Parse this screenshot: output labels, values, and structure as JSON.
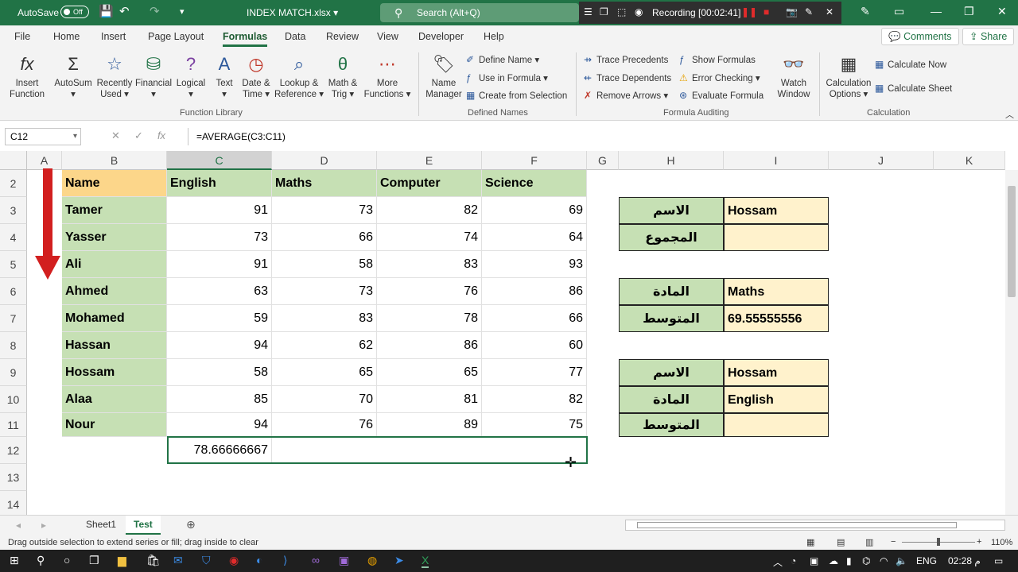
{
  "titlebar": {
    "autosave_label": "AutoSave",
    "autosave_state": "Off",
    "filename": "INDEX MATCH.xlsx",
    "search_placeholder": "Search (Alt+Q)",
    "recording_label": "Recording [00:02:41]"
  },
  "tabs": [
    "File",
    "Home",
    "Insert",
    "Page Layout",
    "Formulas",
    "Data",
    "Review",
    "View",
    "Developer",
    "Help"
  ],
  "active_tab": "Formulas",
  "comments_label": "Comments",
  "share_label": "Share",
  "ribbon": {
    "function_library": {
      "insert_function_1": "Insert",
      "insert_function_2": "Function",
      "autosum": "AutoSum",
      "recently_used_1": "Recently",
      "recently_used_2": "Used",
      "financial": "Financial",
      "logical": "Logical",
      "text": "Text",
      "date_time_1": "Date &",
      "date_time_2": "Time",
      "lookup_1": "Lookup &",
      "lookup_2": "Reference",
      "math_1": "Math &",
      "math_2": "Trig",
      "more_1": "More",
      "more_2": "Functions",
      "label": "Function Library"
    },
    "defined_names": {
      "name_manager_1": "Name",
      "name_manager_2": "Manager",
      "define_name": "Define Name",
      "use_in_formula": "Use in Formula",
      "create_from_selection": "Create from Selection",
      "label": "Defined Names"
    },
    "formula_auditing": {
      "trace_precedents": "Trace Precedents",
      "trace_dependents": "Trace Dependents",
      "remove_arrows": "Remove Arrows",
      "show_formulas": "Show Formulas",
      "error_checking": "Error Checking",
      "evaluate_formula": "Evaluate Formula",
      "watch_window_1": "Watch",
      "watch_window_2": "Window",
      "label": "Formula Auditing"
    },
    "calculation": {
      "calc_options_1": "Calculation",
      "calc_options_2": "Options",
      "calculate_now": "Calculate Now",
      "calculate_sheet": "Calculate Sheet",
      "label": "Calculation"
    }
  },
  "formula_bar": {
    "name_box": "C12",
    "formula": "=AVERAGE(C3:C11)"
  },
  "columns": [
    "A",
    "B",
    "C",
    "D",
    "E",
    "F",
    "G",
    "H",
    "I",
    "J",
    "K"
  ],
  "rows": [
    "2",
    "3",
    "4",
    "5",
    "6",
    "7",
    "8",
    "9",
    "10",
    "11",
    "12",
    "13",
    "14"
  ],
  "table": {
    "headers": [
      "Name",
      "English",
      "Maths",
      "Computer",
      "Science"
    ],
    "rows": [
      [
        "Tamer",
        "91",
        "73",
        "82",
        "69"
      ],
      [
        "Yasser",
        "73",
        "66",
        "74",
        "64"
      ],
      [
        "Ali",
        "91",
        "58",
        "83",
        "93"
      ],
      [
        "Ahmed",
        "63",
        "73",
        "76",
        "86"
      ],
      [
        "Mohamed",
        "59",
        "83",
        "78",
        "66"
      ],
      [
        "Hassan",
        "94",
        "62",
        "86",
        "60"
      ],
      [
        "Hossam",
        "58",
        "65",
        "65",
        "77"
      ],
      [
        "Alaa",
        "85",
        "70",
        "81",
        "82"
      ],
      [
        "Nour",
        "94",
        "76",
        "89",
        "75"
      ]
    ],
    "average_c12": "78.66666667"
  },
  "lookup1": {
    "label_name": "الاسم",
    "value_name": "Hossam",
    "label_total": "المجموع",
    "value_total": ""
  },
  "lookup2": {
    "label_subject": "المادة",
    "value_subject": "Maths",
    "label_avg": "المتوسط",
    "value_avg": "69.55555556"
  },
  "lookup3": {
    "label_name": "الاسم",
    "value_name": "Hossam",
    "label_subject": "المادة",
    "value_subject": "English",
    "label_avg": "المتوسط",
    "value_avg": ""
  },
  "sheets": [
    "Sheet1",
    "Test"
  ],
  "active_sheet": "Test",
  "status_message": "Drag outside selection to extend series or fill; drag inside to clear",
  "zoom": "110%",
  "taskbar": {
    "lang": "ENG",
    "time": "02:28 م"
  },
  "colors": {
    "excel_green": "#217346",
    "header_green": "#c6e0b4",
    "header_orange": "#fcd68a",
    "value_yellow": "#fff2cc"
  }
}
